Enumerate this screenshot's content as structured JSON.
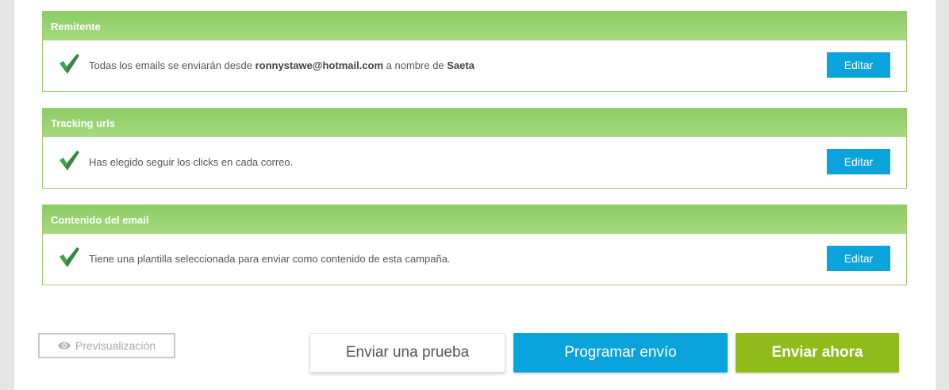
{
  "sections": [
    {
      "title": "Remitente",
      "text_prefix": "Todas los emails se enviarán desde ",
      "email": "ronnystawe@hotmail.com",
      "text_mid": " a nombre de ",
      "sender_name": "Saeta",
      "edit_label": "Editar"
    },
    {
      "title": "Tracking urls",
      "text": "Has elegido seguir los clicks en cada correo.",
      "edit_label": "Editar"
    },
    {
      "title": "Contenido del email",
      "text": "Tiene una plantilla seleccionada para enviar como contenido de esta campaña.",
      "edit_label": "Editar"
    }
  ],
  "actions": {
    "preview_label": "Previsualización",
    "test_label": "Enviar una prueba",
    "schedule_label": "Programar envío",
    "send_now_label": "Enviar ahora"
  },
  "icons": {
    "check": "check-icon",
    "eye": "eye-icon"
  },
  "colors": {
    "header_green": "#8ccc62",
    "accent_blue": "#0aa3dc",
    "send_green": "#8fbc1b"
  }
}
